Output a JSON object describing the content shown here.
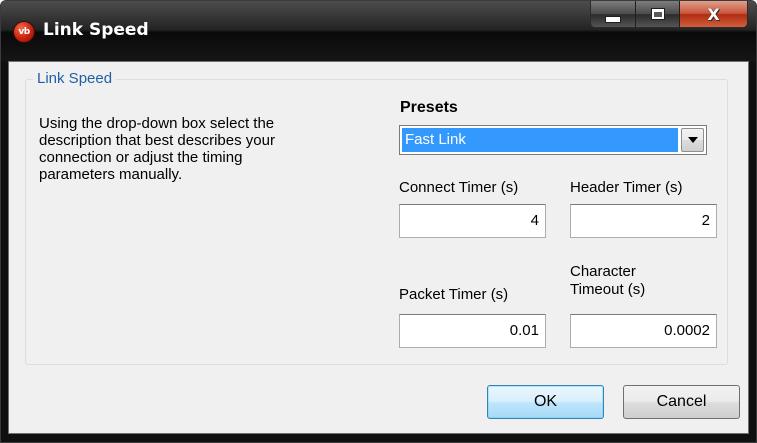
{
  "window": {
    "title": "Link Speed",
    "app_icon_text": "vb",
    "controls": {
      "minimize": "minimize",
      "maximize": "maximize",
      "close": "X"
    }
  },
  "group": {
    "legend": "Link Speed",
    "description": "Using the drop-down box select the description that best describes your connection or adjust the timing parameters manually."
  },
  "presets": {
    "label": "Presets",
    "selected": "Fast Link"
  },
  "fields": {
    "connect_timer": {
      "label": "Connect Timer (s)",
      "value": "4"
    },
    "header_timer": {
      "label": "Header Timer (s)",
      "value": "2"
    },
    "packet_timer": {
      "label": "Packet Timer (s)",
      "value": "0.01"
    },
    "character_timeout": {
      "label_line1": "Character",
      "label_line2": "Timeout (s)",
      "value": "0.0002"
    }
  },
  "buttons": {
    "ok": "OK",
    "cancel": "Cancel"
  },
  "icons": {
    "app": "vb-app-icon",
    "minimize": "minimize-icon",
    "maximize": "maximize-icon",
    "close": "close-icon",
    "dropdown": "chevron-down-icon"
  }
}
